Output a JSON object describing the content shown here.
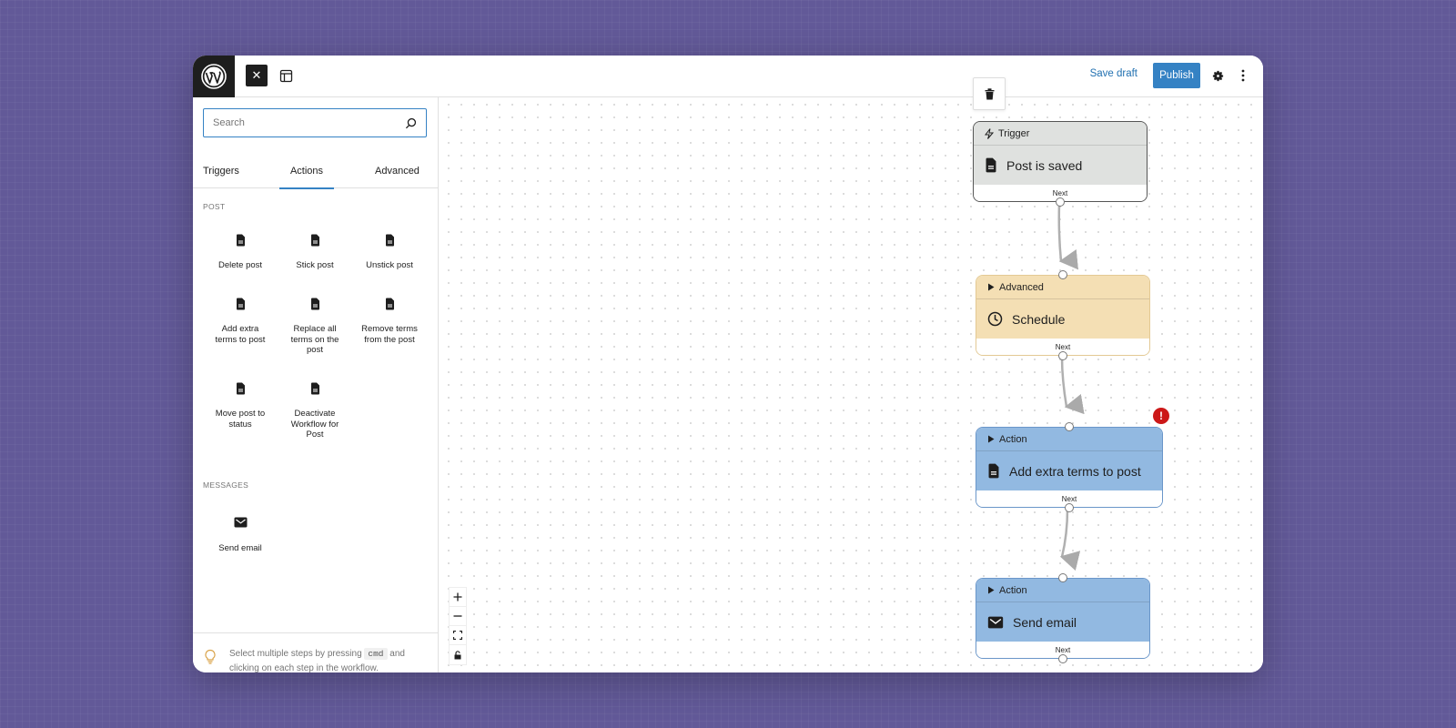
{
  "header": {
    "logo": "wordpress-logo",
    "close_label": "✕",
    "save_draft": "Save draft",
    "publish": "Publish"
  },
  "sidebar": {
    "search_placeholder": "Search",
    "tabs": [
      {
        "label": "Triggers",
        "active": false
      },
      {
        "label": "Actions",
        "active": true
      },
      {
        "label": "Advanced",
        "active": false
      }
    ],
    "sections": [
      {
        "title": "POST",
        "items": [
          {
            "label": "Delete post",
            "icon": "post-icon"
          },
          {
            "label": "Stick post",
            "icon": "post-icon"
          },
          {
            "label": "Unstick post",
            "icon": "post-icon"
          },
          {
            "label": "Add extra terms to post",
            "icon": "post-icon"
          },
          {
            "label": "Replace all terms on the post",
            "icon": "post-icon"
          },
          {
            "label": "Remove terms from the post",
            "icon": "post-icon"
          },
          {
            "label": "Move post to status",
            "icon": "post-icon"
          },
          {
            "label": "Deactivate Workflow for Post",
            "icon": "post-icon"
          }
        ]
      },
      {
        "title": "MESSAGES",
        "items": [
          {
            "label": "Send email",
            "icon": "envelope-icon"
          }
        ]
      }
    ],
    "tip": {
      "before": "Select multiple steps by pressing",
      "key": "cmd",
      "after": "and clicking on each step in the workflow."
    }
  },
  "workflow": {
    "nodes": [
      {
        "type": "Trigger",
        "title": "Post is saved",
        "footer": "Next",
        "icon": "post-icon",
        "header_icon": "lightning-icon",
        "error": false
      },
      {
        "type": "Advanced",
        "title": "Schedule",
        "footer": "Next",
        "icon": "clock-icon",
        "header_icon": "triangle-right-icon",
        "error": false
      },
      {
        "type": "Action",
        "title": "Add extra terms to post",
        "footer": "Next",
        "icon": "post-icon",
        "header_icon": "triangle-right-icon",
        "error": true
      },
      {
        "type": "Action",
        "title": "Send email",
        "footer": "Next",
        "icon": "envelope-icon",
        "header_icon": "triangle-right-icon",
        "error": false
      }
    ],
    "error_badge": "!"
  },
  "colors": {
    "accent": "#3582c4",
    "trigger_bg": "#dfe1df",
    "advanced_bg": "#f4dfb4",
    "action_bg": "#92b9e1",
    "error": "#cc1818",
    "page_bg": "#625998"
  }
}
